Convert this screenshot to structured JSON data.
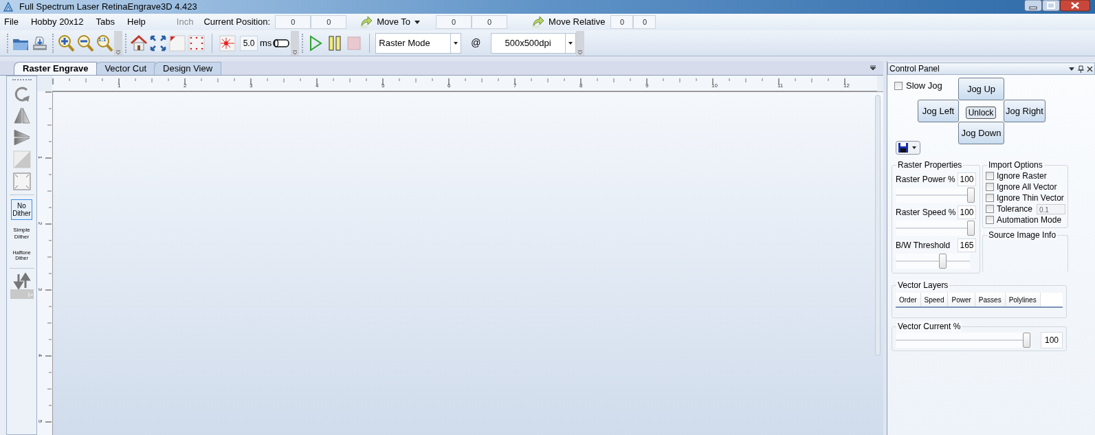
{
  "window": {
    "title": "Full Spectrum Laser RetinaEngrave3D 4.423"
  },
  "menu": [
    "File",
    "Hobby 20x12",
    "Tabs",
    "Help"
  ],
  "unit": {
    "text": "Inch",
    "disabled": true
  },
  "current_position": {
    "label": "Current Position:",
    "values": [
      "0",
      "0"
    ]
  },
  "move_to": {
    "label": "Move To",
    "values": [
      "0",
      "0"
    ]
  },
  "move_relative": {
    "label": "Move Relative",
    "values": [
      "0",
      "0"
    ]
  },
  "toolbar": {
    "zoom_actual": "1:1",
    "pulse": "5.0",
    "pulse_unit": "ms",
    "mode": "Raster Mode",
    "at": "@",
    "resolution": "500x500dpi"
  },
  "tabs": [
    {
      "label": "Raster Engrave",
      "selected": true
    },
    {
      "label": "Vector Cut",
      "selected": false
    },
    {
      "label": "Design View",
      "selected": false
    }
  ],
  "dither_options": [
    {
      "label": "No Dither",
      "selected": true
    },
    {
      "label": "Simple Dither",
      "selected": false
    },
    {
      "label": "Halftone Dither",
      "selected": false
    }
  ],
  "ruler": {
    "x_labels": [
      "1",
      "2",
      "3",
      "4",
      "5",
      "6",
      "7",
      "8",
      "9",
      "10",
      "11",
      "12"
    ],
    "y_labels": [
      "1",
      "2",
      "3",
      "4",
      "5"
    ]
  },
  "control_panel": {
    "title": "Control Panel",
    "slow_jog": {
      "label": "Slow Jog",
      "checked": false
    },
    "jog": {
      "up": "Jog Up",
      "left": "Jog Left",
      "unlock": "Unlock",
      "right": "Jog Right",
      "down": "Jog Down"
    },
    "raster_properties": {
      "title": "Raster Properties",
      "fields": [
        {
          "label": "Raster Power %",
          "value": "100",
          "level": 1
        },
        {
          "label": "Raster Speed %",
          "value": "100",
          "level": 1
        },
        {
          "label": "B/W Threshold",
          "value": "165",
          "level": 0.65
        }
      ]
    },
    "import_options": {
      "title": "Import Options",
      "options": [
        {
          "label": "Ignore Raster",
          "checked": false
        },
        {
          "label": "Ignore All Vector",
          "checked": false
        },
        {
          "label": "Ignore Thin Vector",
          "checked": false
        },
        {
          "label": "Tolerance",
          "checked": false,
          "value": "0.1"
        },
        {
          "label": "Automation Mode",
          "checked": false
        }
      ]
    },
    "source_image_info": {
      "title": "Source Image Info"
    },
    "vector_layers": {
      "title": "Vector Layers",
      "columns": [
        "Order",
        "Speed",
        "Power",
        "Passes",
        "Polylines"
      ]
    },
    "vector_current": {
      "title": "Vector Current %",
      "level": 1,
      "value": "100"
    }
  }
}
